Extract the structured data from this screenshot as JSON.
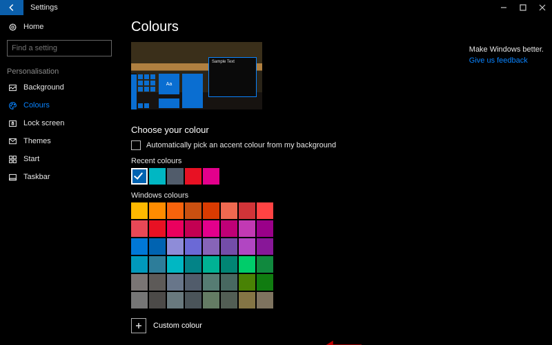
{
  "titlebar": {
    "app_title": "Settings"
  },
  "sidebar": {
    "home": "Home",
    "search_placeholder": "Find a setting",
    "category_header": "Personalisation",
    "items": [
      {
        "label": "Background"
      },
      {
        "label": "Colours"
      },
      {
        "label": "Lock screen"
      },
      {
        "label": "Themes"
      },
      {
        "label": "Start"
      },
      {
        "label": "Taskbar"
      }
    ]
  },
  "page": {
    "title": "Colours",
    "preview": {
      "tile_label": "Aa",
      "window_text": "Sample Text"
    },
    "choose_heading": "Choose your colour",
    "auto_checkbox_label": "Automatically pick an accent colour from my background",
    "recent_heading": "Recent colours",
    "recent_colours": [
      "#0063b1",
      "#00b7c3",
      "#515c6b",
      "#e81123",
      "#e3008c"
    ],
    "recent_selected_index": 0,
    "windows_heading": "Windows colours",
    "windows_colours": [
      "#ffb900",
      "#ff8c00",
      "#f7630c",
      "#ca5010",
      "#da3b01",
      "#ef6950",
      "#d13438",
      "#ff4343",
      "#e74856",
      "#e81123",
      "#ea005e",
      "#c30052",
      "#e3008c",
      "#bf0077",
      "#c239b3",
      "#9a0089",
      "#0078d7",
      "#0063b1",
      "#8e8cd8",
      "#6b69d6",
      "#8764b8",
      "#744da9",
      "#b146c2",
      "#881798",
      "#0099bc",
      "#2d7d9a",
      "#00b7c3",
      "#038387",
      "#00b294",
      "#018574",
      "#00cc6a",
      "#10893e",
      "#7a7574",
      "#5d5a58",
      "#68768a",
      "#515c6b",
      "#567c73",
      "#486860",
      "#498205",
      "#107c10",
      "#767676",
      "#4c4a48",
      "#69797e",
      "#4a5459",
      "#647c64",
      "#525e54",
      "#847545",
      "#7e735f"
    ],
    "custom_colour_label": "Custom colour"
  },
  "feedback": {
    "heading": "Make Windows better.",
    "link_text": "Give us feedback"
  },
  "colors": {
    "accent": "#0a84ff",
    "selected_accent": "#0063b1"
  }
}
